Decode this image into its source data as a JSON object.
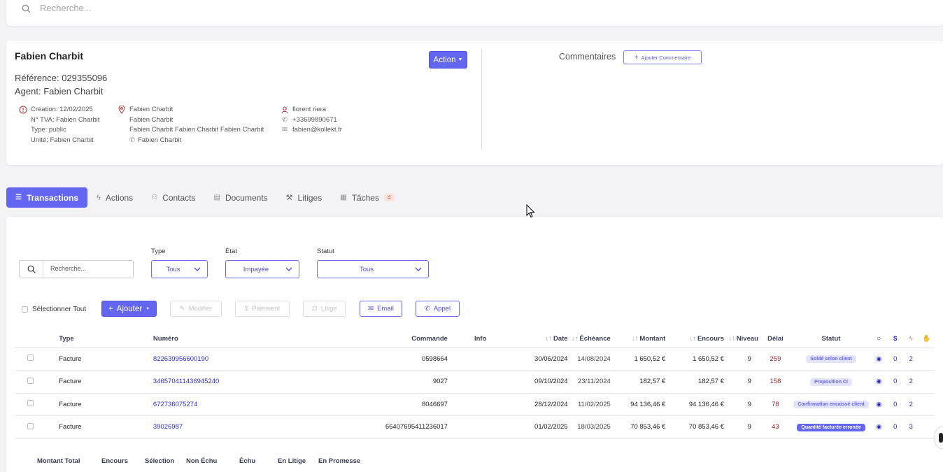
{
  "search": {
    "placeholder": "Recherche..."
  },
  "client": {
    "name": "Fabien Charbit",
    "reference": "Référence: 029355096",
    "agent": "Agent: Fabien Charbit",
    "action_label": "Action",
    "comments_label": "Commentaires",
    "add_comment_label": "Ajouter Commentaire",
    "info": [
      "Création: 12/02/2025",
      "N° TVA: Fabien Charbit",
      "Type: public",
      "Unité: Fabien Charbit"
    ],
    "address": [
      "Fabien Charbit",
      "Fabien Charbit",
      "Fabien Charbit Fabien Charbit Fabien Charbit",
      "Fabien Charbit"
    ],
    "contact": [
      "florent riera",
      "+33699890671",
      "fabien@kollekt.fr"
    ]
  },
  "tabs": [
    {
      "label": "Transactions"
    },
    {
      "label": "Actions"
    },
    {
      "label": "Contacts"
    },
    {
      "label": "Documents"
    },
    {
      "label": "Litiges"
    },
    {
      "label": "Tâches",
      "badge": "4"
    }
  ],
  "filters": {
    "search_placeholder": "Recherche...",
    "type_label": "Type",
    "type_value": "Tous",
    "etat_label": "État",
    "etat_value": "Impayée",
    "statut_label": "Statut",
    "statut_value": "Tous"
  },
  "actions": {
    "select_all": "Sélectionner Tout",
    "add": "Ajouter",
    "edit": "Modifier",
    "payment": "Paiement",
    "dispute": "Litige",
    "email": "Email",
    "call": "Appel"
  },
  "table": {
    "headers": {
      "type": "Type",
      "numero": "Numéro",
      "commande": "Commande",
      "info": "Info",
      "date": "Date",
      "echeance": "Échéance",
      "montant": "Montant",
      "encours": "Encours",
      "niveau": "Niveau",
      "delai": "Délai",
      "statut": "Statut"
    },
    "rows": [
      {
        "type": "Facture",
        "numero": "822639956600190",
        "commande": "0598664",
        "info": "",
        "date": "30/06/2024",
        "echeance": "14/08/2024",
        "montant": "1 650,52 €",
        "encours": "1 650,52 €",
        "niveau": "9",
        "delai": "259",
        "statut": "Soldé selon client",
        "comments": "0",
        "actions": "2"
      },
      {
        "type": "Facture",
        "numero": "346570411436945240",
        "commande": "9027",
        "info": "",
        "date": "09/10/2024",
        "echeance": "23/11/2024",
        "montant": "182,57 €",
        "encours": "182,57 €",
        "niveau": "9",
        "delai": "158",
        "statut": "Proposition CI",
        "comments": "0",
        "actions": "2"
      },
      {
        "type": "Facture",
        "numero": "672736075274",
        "commande": "8046697",
        "info": "",
        "date": "28/12/2024",
        "echeance": "11/02/2025",
        "montant": "94 136,46 €",
        "encours": "94 136,46 €",
        "niveau": "9",
        "delai": "78",
        "statut": "Confirmation encaissé client",
        "comments": "0",
        "actions": "2"
      },
      {
        "type": "Facture",
        "numero": "39026987",
        "commande": "66407695411236017",
        "info": "",
        "date": "01/02/2025",
        "echeance": "18/03/2025",
        "montant": "70 853,46 €",
        "encours": "70 853,46 €",
        "niveau": "9",
        "delai": "43",
        "statut": "Quantité facturée erronée",
        "comments": "0",
        "actions": "3"
      }
    ]
  },
  "totals": [
    "Montant Total",
    "Encours",
    "Sélection",
    "Non Échu",
    "Échu",
    "En Litige",
    "En Promesse"
  ],
  "colors": {
    "accent": "#6366f1",
    "link": "#2b2fc4",
    "delay": "#8a1f1f"
  }
}
